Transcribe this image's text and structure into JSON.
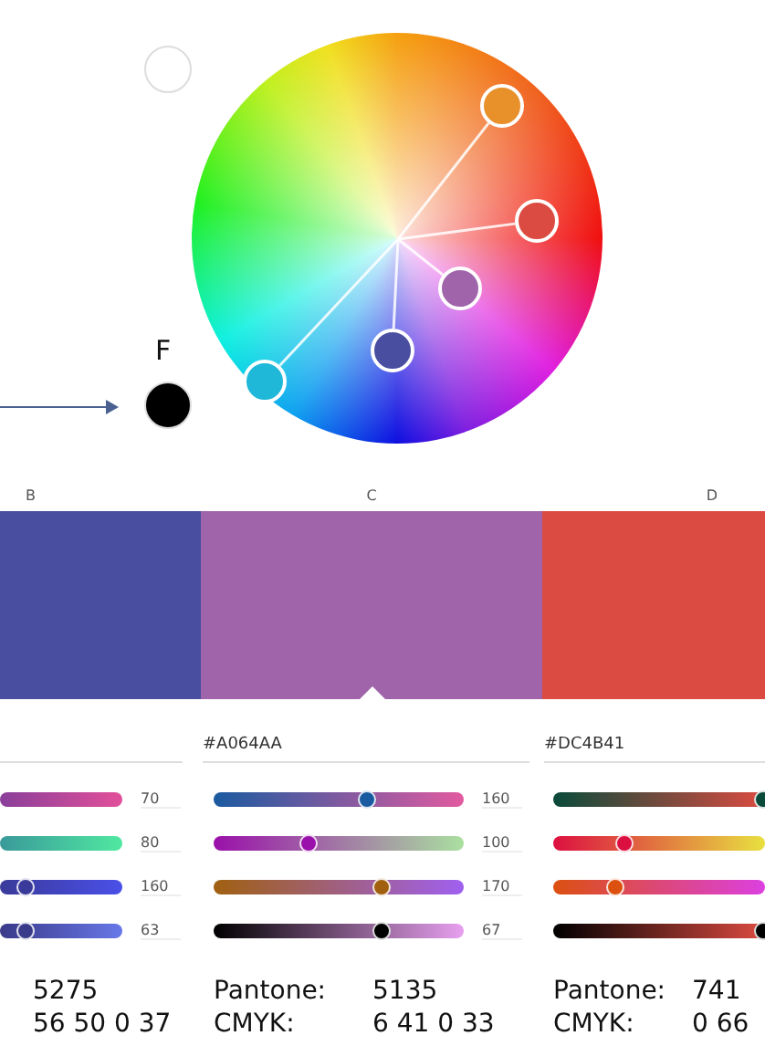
{
  "wheel": {
    "handles": [
      {
        "color": "#e8902a"
      },
      {
        "color": "#dc4b41"
      },
      {
        "color": "#a064aa"
      },
      {
        "color": "#4a4ea0"
      },
      {
        "color": "#1fb8d8"
      }
    ]
  },
  "base_swatches": [
    {
      "color": "#ffffff"
    },
    {
      "color": "#000000",
      "label": "F"
    }
  ],
  "columns": [
    {
      "label": "B",
      "color": "#4a4ea0",
      "selected": false,
      "sliders": [
        {
          "reading": "70"
        },
        {
          "reading": "80"
        },
        {
          "level": 0.21,
          "reading": "160"
        },
        {
          "level": 0.21,
          "reading": "63"
        }
      ],
      "pantone": {
        "value": "5275"
      },
      "cmyk": {
        "value": "56 50 0 37"
      }
    },
    {
      "label": "C",
      "color": "#a064aa",
      "selected": true,
      "hex": "#A064AA",
      "sliders": [
        {
          "level": 0.61,
          "reading": "160"
        },
        {
          "level": 0.38,
          "reading": "100"
        },
        {
          "level": 0.67,
          "reading": "170"
        },
        {
          "level": 0.67,
          "reading": "67"
        }
      ],
      "pantone": {
        "label": "Pantone:",
        "value": "5135"
      },
      "cmyk": {
        "label": "CMYK:",
        "value": "6 41 0 33"
      }
    },
    {
      "label": "D",
      "color": "#dc4b41",
      "selected": false,
      "hex": "#DC4B41",
      "sliders": [
        {
          "level": 0.99
        },
        {
          "level": 0.34
        },
        {
          "level": 0.29
        },
        {
          "level": 0.99
        }
      ],
      "pantone": {
        "label": "Pantone:",
        "value": "741"
      },
      "cmyk": {
        "label": "CMYK:",
        "value": "0 66"
      }
    }
  ]
}
